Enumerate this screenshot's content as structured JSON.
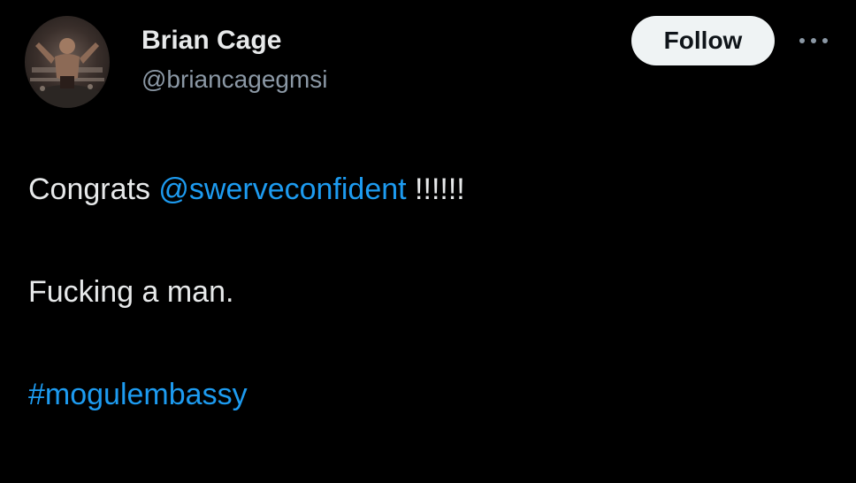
{
  "author": {
    "display_name": "Brian Cage",
    "handle": "@briancagegmsi",
    "avatar_icon": "profile-photo"
  },
  "actions": {
    "follow_label": "Follow",
    "more_icon": "more-horizontal-icon"
  },
  "tweet": {
    "line1_prefix": "Congrats ",
    "line1_mention": "@swerveconfident",
    "line1_suffix": " !!!!!!",
    "line2": "Fucking a man.",
    "line3_hashtag": "#mogulembassy"
  },
  "colors": {
    "background": "#000000",
    "primary_text": "#e7e9ea",
    "secondary_text": "#8b98a5",
    "link": "#1d9bf0",
    "follow_bg": "#eff3f4"
  }
}
